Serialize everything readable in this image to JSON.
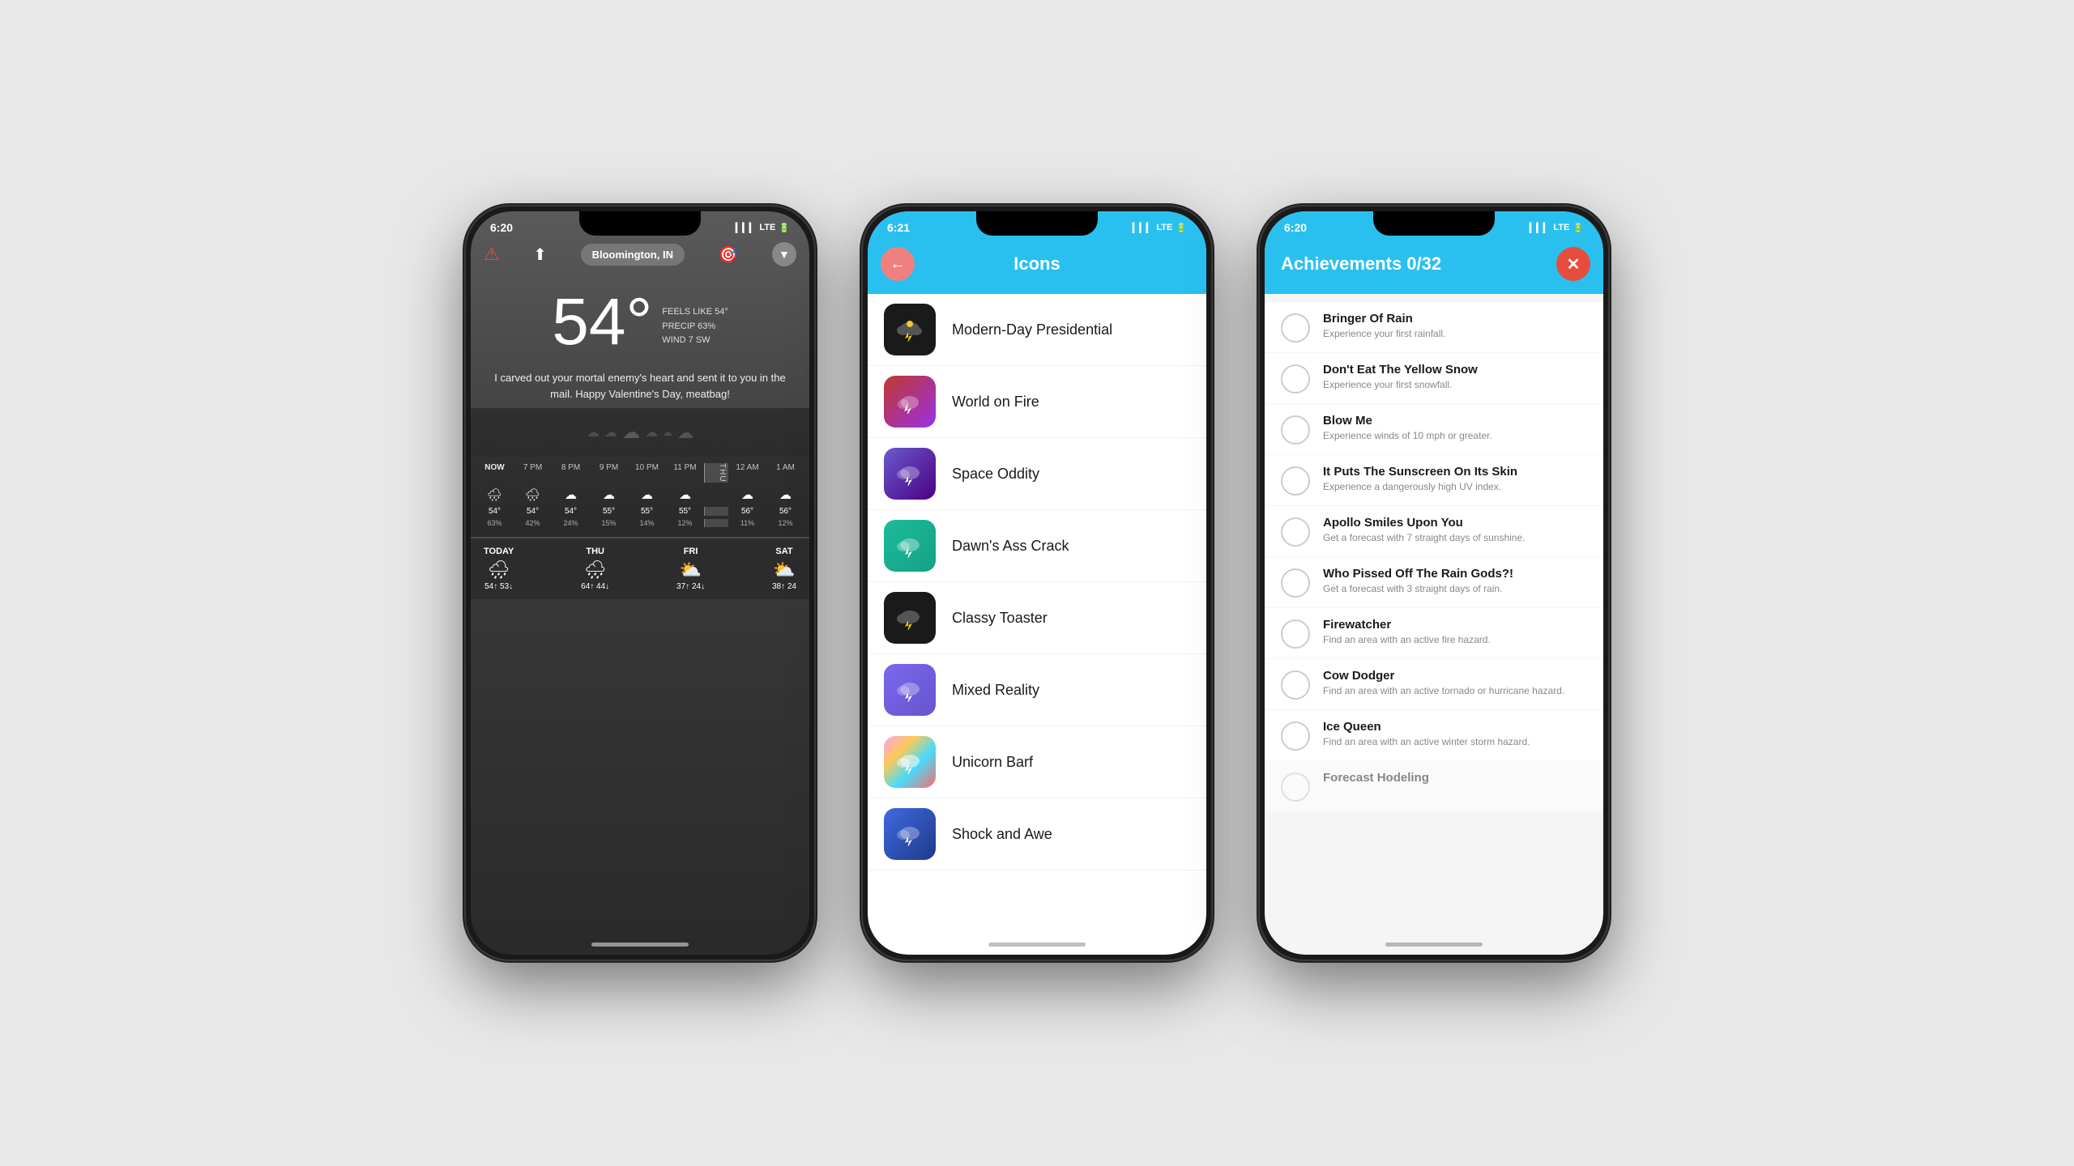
{
  "phone1": {
    "status_time": "6:20",
    "status_arrow": "↑",
    "signal": "▎▎▎",
    "lte": "LTE",
    "battery": "▮▮▮▮",
    "location": "Bloomington, IN",
    "temperature": "54°",
    "feels_like": "FEELS LIKE 54°",
    "precip": "PRECIP 63%",
    "wind": "WIND 7 SW",
    "message": "I carved out your mortal enemy's heart and sent it to you in the mail. Happy Valentine's Day, meatbag!",
    "hours": [
      "NOW",
      "7 PM",
      "8 PM",
      "9 PM",
      "10 PM",
      "11 PM",
      "12 AM",
      "1 AM"
    ],
    "hour_temps": [
      "54°",
      "54°",
      "54°",
      "55°",
      "55°",
      "55°",
      "56°",
      "56°"
    ],
    "hour_precip": [
      "63%",
      "42%",
      "24%",
      "15%",
      "14%",
      "12%",
      "11%",
      "12%"
    ],
    "thursday_label": "THURSDAY",
    "daily": [
      {
        "day": "TODAY",
        "icon": "🌧",
        "high": "54↑",
        "low": "53↓"
      },
      {
        "day": "THU",
        "icon": "🌧",
        "high": "64↑",
        "low": "44↓"
      },
      {
        "day": "FRI",
        "icon": "⛅",
        "high": "37↑",
        "low": "24↓"
      },
      {
        "day": "SAT",
        "icon": "⛅",
        "high": "38↑",
        "low": "24"
      }
    ]
  },
  "phone2": {
    "status_time": "6:21",
    "signal": "▎▎▎",
    "lte": "LTE",
    "battery": "▮▮▮▮",
    "header_title": "Icons",
    "back_arrow": "←",
    "icons": [
      {
        "name": "Modern-Day Presidential",
        "bg": "presidential"
      },
      {
        "name": "World on Fire",
        "bg": "world-fire"
      },
      {
        "name": "Space Oddity",
        "bg": "space-oddity"
      },
      {
        "name": "Dawn's Ass Crack",
        "bg": "dawns-crack"
      },
      {
        "name": "Classy Toaster",
        "bg": "classy-toaster"
      },
      {
        "name": "Mixed Reality",
        "bg": "mixed-reality"
      },
      {
        "name": "Unicorn Barf",
        "bg": "unicorn-barf"
      },
      {
        "name": "Shock and Awe",
        "bg": "shock-awe"
      }
    ]
  },
  "phone3": {
    "status_time": "6:20",
    "signal": "▎▎▎",
    "lte": "LTE",
    "battery": "▮▮▮▮",
    "header_title": "Achievements 0/32",
    "close_btn": "✕",
    "achievements": [
      {
        "name": "Bringer Of Rain",
        "desc": "Experience your first rainfall."
      },
      {
        "name": "Don't Eat The Yellow Snow",
        "desc": "Experience your first snowfall."
      },
      {
        "name": "Blow Me",
        "desc": "Experience winds of 10 mph or greater."
      },
      {
        "name": "It Puts The Sunscreen On Its Skin",
        "desc": "Experience a dangerously high UV index."
      },
      {
        "name": "Apollo Smiles Upon You",
        "desc": "Get a forecast with 7 straight days of sunshine."
      },
      {
        "name": "Who Pissed Off The Rain Gods?!",
        "desc": "Get a forecast with 3 straight days of rain."
      },
      {
        "name": "Firewatcher",
        "desc": "Find an area with an active fire hazard."
      },
      {
        "name": "Cow Dodger",
        "desc": "Find an area with an active tornado or hurricane hazard."
      },
      {
        "name": "Ice Queen",
        "desc": "Find an area with an active winter storm hazard."
      },
      {
        "name": "Forecast Hodeling",
        "desc": ""
      }
    ]
  }
}
